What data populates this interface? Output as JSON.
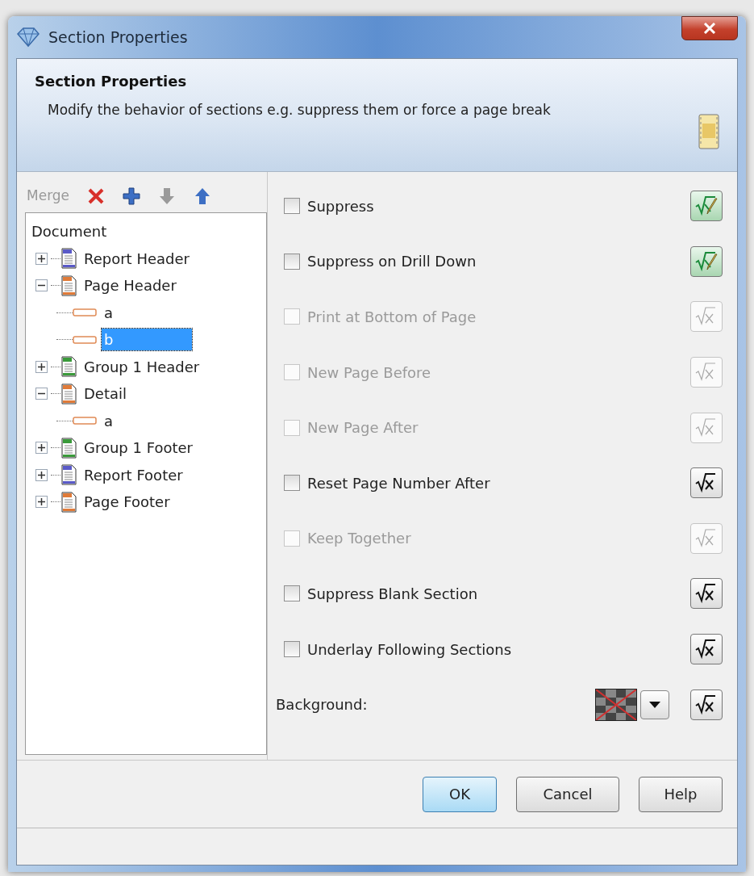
{
  "window": {
    "title": "Section Properties"
  },
  "header": {
    "title": "Section Properties",
    "description": "Modify the behavior of sections e.g. suppress them or force a page break"
  },
  "toolbar": [
    {
      "kind": "merge",
      "label": "Merge",
      "disabled": true
    },
    {
      "kind": "delete",
      "disabled": false
    },
    {
      "kind": "add",
      "disabled": false
    },
    {
      "kind": "down",
      "disabled": true
    },
    {
      "kind": "up",
      "disabled": false
    }
  ],
  "tree": {
    "label": "Document",
    "children": [
      {
        "label": "Report Header",
        "kind": "section",
        "color": "#5a5ac8",
        "expanded": false,
        "selected": false
      },
      {
        "label": "Page Header",
        "kind": "section",
        "color": "#e07b39",
        "expanded": true,
        "selected": false,
        "children": [
          {
            "label": "a",
            "kind": "element",
            "selected": false
          },
          {
            "label": "b",
            "kind": "element",
            "selected": true
          }
        ]
      },
      {
        "label": "Group 1 Header",
        "kind": "section",
        "color": "#3a9a3a",
        "expanded": false,
        "selected": false
      },
      {
        "label": "Detail",
        "kind": "section",
        "color": "#e07b39",
        "expanded": true,
        "selected": false,
        "children": [
          {
            "label": "a",
            "kind": "element",
            "selected": false
          }
        ]
      },
      {
        "label": "Group 1 Footer",
        "kind": "section",
        "color": "#3a9a3a",
        "expanded": false,
        "selected": false
      },
      {
        "label": "Report Footer",
        "kind": "section",
        "color": "#5a5ac8",
        "expanded": false,
        "selected": false
      },
      {
        "label": "Page Footer",
        "kind": "section",
        "color": "#e07b39",
        "expanded": false,
        "selected": false
      }
    ]
  },
  "options": [
    {
      "label": "Suppress",
      "checked": false,
      "disabled": false,
      "formula_set": true
    },
    {
      "label": "Suppress on Drill Down",
      "checked": false,
      "disabled": false,
      "formula_set": true
    },
    {
      "label": "Print at Bottom of Page",
      "checked": false,
      "disabled": true,
      "formula_set": false
    },
    {
      "label": "New Page Before",
      "checked": false,
      "disabled": true,
      "formula_set": false
    },
    {
      "label": "New Page After",
      "checked": false,
      "disabled": true,
      "formula_set": false
    },
    {
      "label": "Reset Page Number After",
      "checked": false,
      "disabled": false,
      "formula_set": false
    },
    {
      "label": "Keep Together",
      "checked": false,
      "disabled": true,
      "formula_set": false
    },
    {
      "label": "Suppress Blank Section",
      "checked": false,
      "disabled": false,
      "formula_set": false
    },
    {
      "label": "Underlay Following Sections",
      "checked": false,
      "disabled": false,
      "formula_set": false
    }
  ],
  "background": {
    "label": "Background:",
    "formula_set": false
  },
  "buttons": [
    {
      "label": "OK",
      "default": true
    },
    {
      "label": "Cancel",
      "default": false
    },
    {
      "label": "Help",
      "default": false
    }
  ]
}
